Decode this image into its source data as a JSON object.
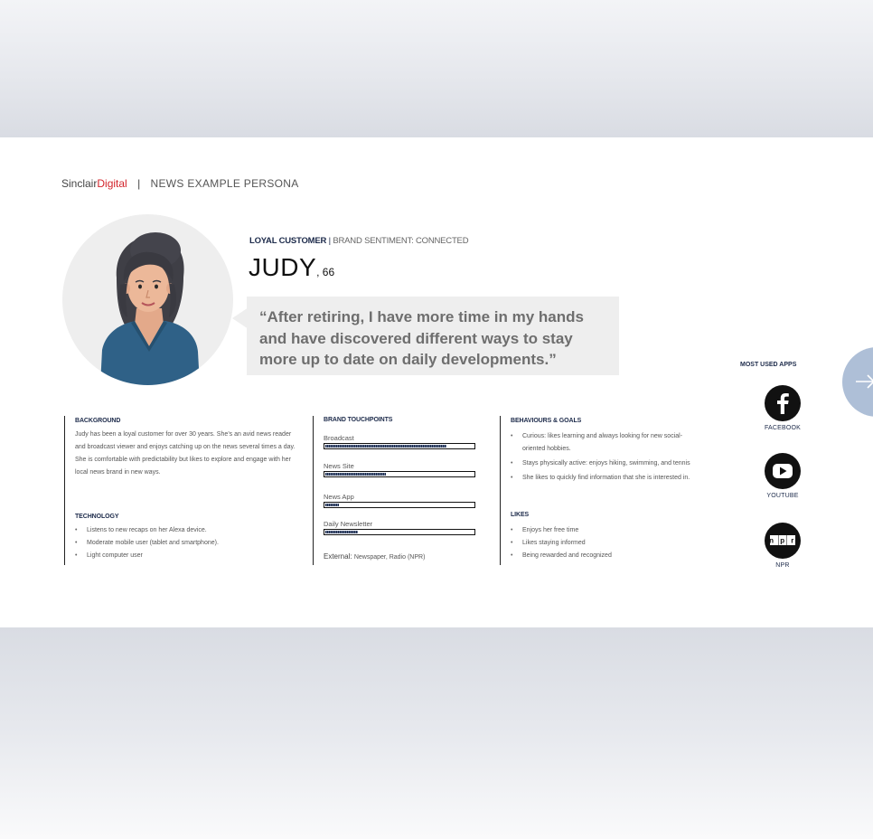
{
  "header": {
    "brand_part1": "Sinclair",
    "brand_part2": "Digital",
    "separator": "|",
    "title": "NEWS EXAMPLE PERSONA"
  },
  "persona": {
    "segment": "LOYAL CUSTOMER",
    "divider": "|",
    "sentiment": "BRAND SENTIMENT: CONNECTED",
    "name": "JUDY",
    "age": ", 66",
    "quote": "“After retiring, I have more time in my hands and have discovered different ways to stay more up to date on daily developments.”"
  },
  "background": {
    "heading": "BACKGROUND",
    "text": "Judy has been a loyal customer for over 30 years. She’s an avid news reader and broadcast viewer and enjoys catching up on the news several times a day. She is comfortable with predictability but likes to explore and engage with her local news brand in new ways."
  },
  "technology": {
    "heading": "TECHNOLOGY",
    "items": [
      "Listens to new recaps on her Alexa device.",
      "Moderate mobile user (tablet and smartphone).",
      "Light computer user"
    ]
  },
  "touchpoints": {
    "heading": "BRAND TOUCHPOINTS",
    "items": [
      {
        "label": "Broadcast",
        "level": 0.82
      },
      {
        "label": "News Site",
        "level": 0.41
      },
      {
        "label": "News App",
        "level": 0.09
      },
      {
        "label": "Daily Newsletter",
        "level": 0.22
      }
    ],
    "external_label": "External:",
    "external_value": "Newspaper, Radio (NPR)"
  },
  "behaviours": {
    "heading": "BEHAVIOURS & GOALS",
    "items": [
      "Curious: likes learning and always looking for new social-oriented hobbies.",
      "Stays physically active: enjoys hiking, swimming, and tennis",
      "She likes to quickly find information that she is interested in."
    ]
  },
  "likes": {
    "heading": "LIKES",
    "items": [
      "Enjoys her free time",
      "Likes staying informed",
      "Being rewarded and recognized"
    ]
  },
  "apps": {
    "heading": "MOST USED APPS",
    "items": [
      {
        "label": "FACEBOOK",
        "icon": "facebook-icon"
      },
      {
        "label": "YOUTUBE",
        "icon": "youtube-icon"
      },
      {
        "label": "NPR",
        "icon": "npr-icon",
        "logo_text": "n p r"
      }
    ]
  },
  "colors": {
    "brand_red": "#d2232a",
    "navy": "#1c2a4a",
    "arrow_tab": "#aebfd7"
  }
}
